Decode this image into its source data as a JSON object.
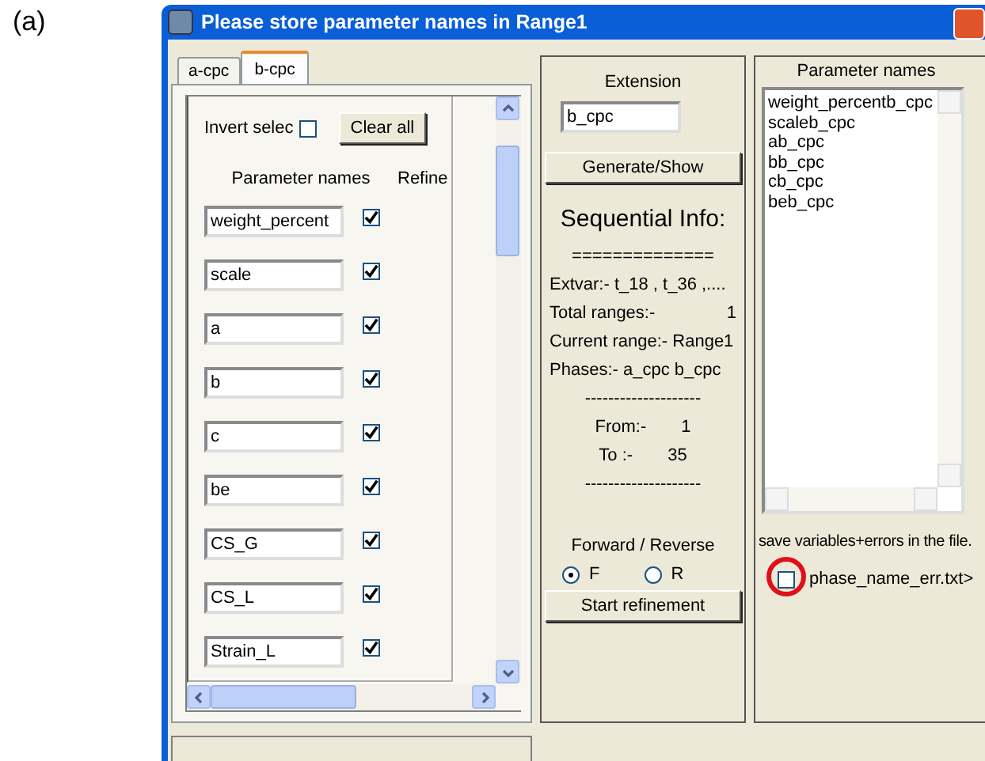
{
  "figure_label": "(a)",
  "window": {
    "title": "Please store parameter names in  Range1"
  },
  "tabs": [
    {
      "label": "a-cpc",
      "selected": false
    },
    {
      "label": "b-cpc",
      "selected": true
    }
  ],
  "selection": {
    "invert_label": "Invert selec",
    "invert_checked": false,
    "clear_button": "Clear all"
  },
  "parameter_table": {
    "columns": [
      "Parameter names",
      "Refine"
    ],
    "rows": [
      {
        "name": "weight_percent",
        "refine": true
      },
      {
        "name": "scale",
        "refine": true
      },
      {
        "name": "a",
        "refine": true
      },
      {
        "name": "b",
        "refine": true
      },
      {
        "name": "c",
        "refine": true
      },
      {
        "name": "be",
        "refine": true
      },
      {
        "name": "CS_G",
        "refine": true
      },
      {
        "name": "CS_L",
        "refine": true
      },
      {
        "name": "Strain_L",
        "refine": true
      }
    ]
  },
  "extension": {
    "label": "Extension",
    "value": "b_cpc"
  },
  "generate_button": "Generate/Show",
  "sequential_info": {
    "title": "Sequential Info:",
    "lines": [
      {
        "kind": "rule",
        "text": "=============="
      },
      {
        "kind": "text",
        "text": "Extvar:-  t_18 , t_36 ,...."
      },
      {
        "kind": "pair",
        "label": "Total ranges:-",
        "value": "1"
      },
      {
        "kind": "text",
        "text": "Current range:- Range1"
      },
      {
        "kind": "text",
        "text": "Phases:-  a_cpc  b_cpc"
      },
      {
        "kind": "rule",
        "text": "--------------------"
      },
      {
        "kind": "short_pair",
        "label": "From:-",
        "value": "1"
      },
      {
        "kind": "short_pair",
        "label": "To :-",
        "value": "35"
      },
      {
        "kind": "rule",
        "text": "--------------------"
      }
    ]
  },
  "direction": {
    "label": "Forward / Reverse",
    "options": [
      {
        "label": "F",
        "selected": true
      },
      {
        "label": "R",
        "selected": false
      }
    ]
  },
  "start_button": "Start refinement",
  "output_names": {
    "title": "Parameter names",
    "items": [
      "weight_percentb_cpc",
      "scaleb_cpc",
      "ab_cpc",
      "bb_cpc",
      "cb_cpc",
      "beb_cpc"
    ]
  },
  "save_errors": {
    "caption": "save variables+errors in the file.",
    "checkbox_label": "phase_name_err.txt>",
    "checked": false,
    "highlighted": true
  }
}
